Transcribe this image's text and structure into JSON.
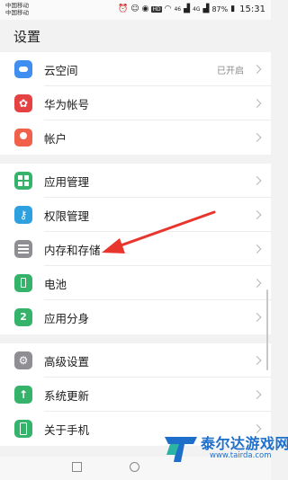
{
  "status_bar": {
    "carrier_1": "中国移动",
    "carrier_2": "中国移动",
    "hd_badge": "HD",
    "network_1": "46",
    "network_2": "4G",
    "battery_percent": "87%",
    "time": "15:31",
    "icons": [
      "alarm-icon",
      "face-icon",
      "eye-icon",
      "wifi-icon",
      "signal-icon",
      "battery-icon"
    ]
  },
  "page": {
    "title": "设置"
  },
  "groups": [
    {
      "items": [
        {
          "label": "云空间",
          "value": "已开启",
          "icon": "cloud-icon"
        },
        {
          "label": "华为帐号",
          "icon": "huawei-icon"
        },
        {
          "label": "帐户",
          "icon": "account-icon"
        }
      ]
    },
    {
      "items": [
        {
          "label": "应用管理",
          "icon": "apps-icon"
        },
        {
          "label": "权限管理",
          "icon": "key-icon"
        },
        {
          "label": "内存和存储",
          "icon": "storage-icon"
        },
        {
          "label": "电池",
          "icon": "battery-icon"
        },
        {
          "label": "应用分身",
          "icon": "app-twin-icon"
        }
      ]
    },
    {
      "items": [
        {
          "label": "高级设置",
          "icon": "gear-icon"
        },
        {
          "label": "系统更新",
          "icon": "update-icon"
        },
        {
          "label": "关于手机",
          "icon": "phone-icon"
        }
      ]
    }
  ],
  "annotation": {
    "color": "#e8362f",
    "points_to": "内存和存储"
  },
  "watermark": {
    "name": "泰尔达游戏网",
    "url": "www.tairda.com"
  },
  "colors": {
    "accent_red": "#e8362f",
    "watermark_blue": "#1e6fc9",
    "green_icon": "#36b36b",
    "blue_icon": "#3f8ef0"
  }
}
